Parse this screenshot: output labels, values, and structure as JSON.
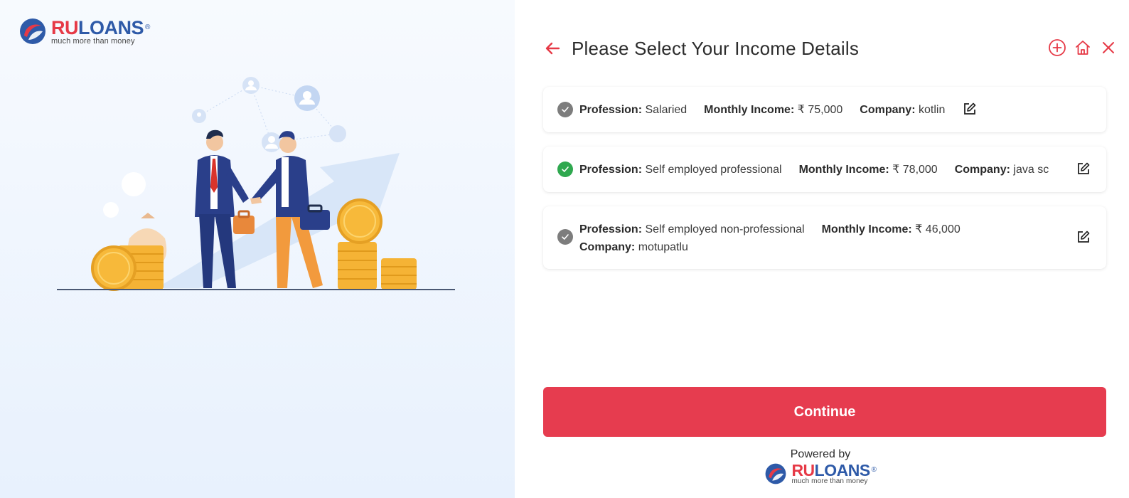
{
  "brand": {
    "name_part1": "RU",
    "name_part2": "LOANS",
    "registered": "®",
    "tagline": "much more than money",
    "colors": {
      "red": "#e63946",
      "blue": "#2e5aa8"
    }
  },
  "header": {
    "title": "Please Select Your Income Details",
    "icons": [
      "back-arrow-icon",
      "add-circle-icon",
      "home-icon",
      "close-icon"
    ]
  },
  "labels": {
    "profession": "Profession:",
    "monthly_income": "Monthly Income:",
    "company": "Company:"
  },
  "incomes": [
    {
      "status": "completed",
      "profession": "Salaried",
      "monthly_income": "₹ 75,000",
      "company": "kotlin"
    },
    {
      "status": "selected",
      "profession": "Self employed professional",
      "monthly_income": "₹ 78,000",
      "company": "java sc"
    },
    {
      "status": "completed",
      "profession": "Self employed non-professional",
      "monthly_income": "₹ 46,000",
      "company": "motupatlu"
    }
  ],
  "actions": {
    "continue_label": "Continue",
    "button_color": "#e63c4f"
  },
  "footer": {
    "powered_by": "Powered by"
  },
  "status_colors": {
    "completed": "#7d7d7d",
    "selected": "#2fa84f"
  }
}
